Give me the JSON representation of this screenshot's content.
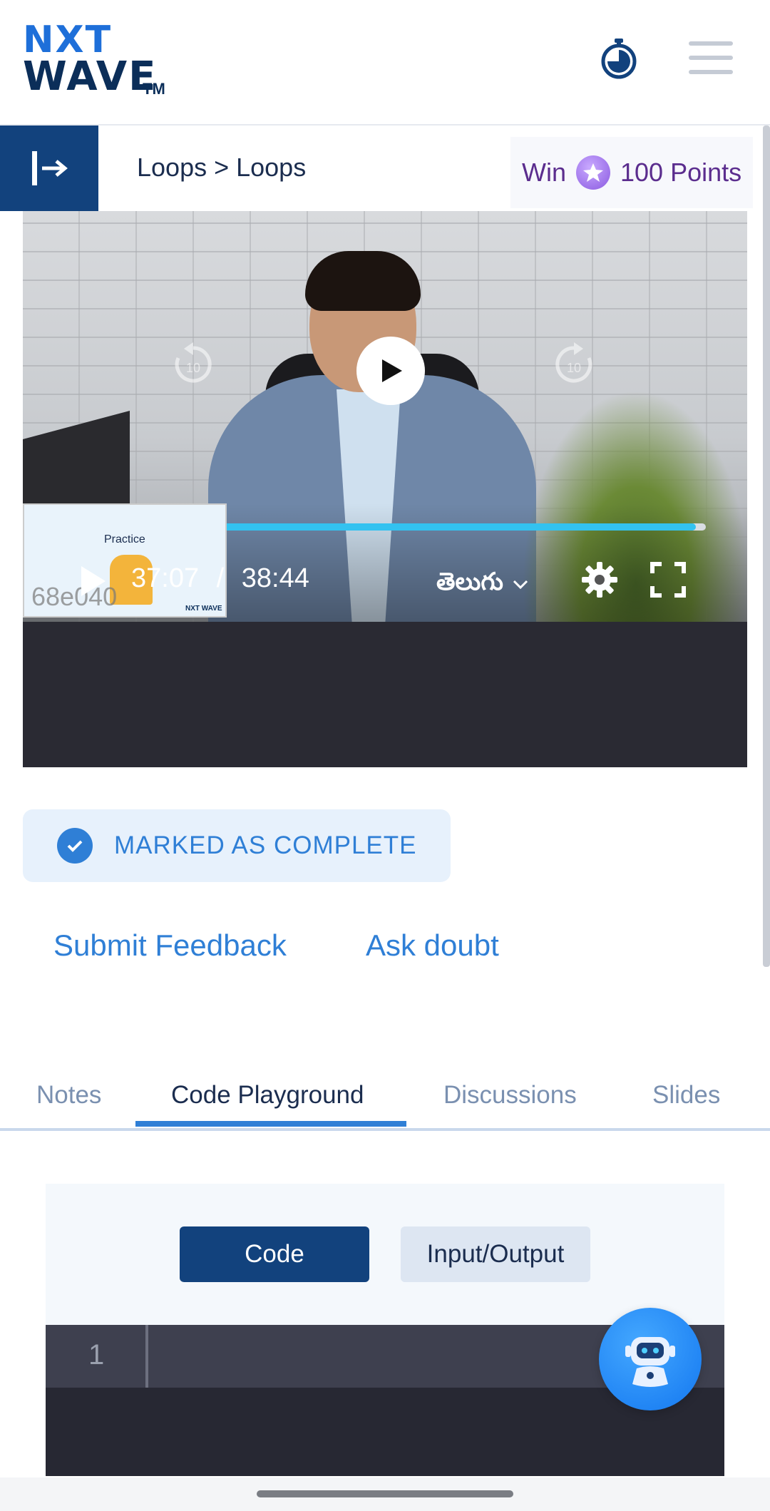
{
  "brand": {
    "logo_top": "NXT",
    "logo_bottom": "WAVE",
    "logo_tm": "TM",
    "accent": "#2f7fd6",
    "navy": "#12427d"
  },
  "header": {
    "timer_icon": "stopwatch-icon",
    "menu_icon": "hamburger-menu-icon"
  },
  "breadcrumb": {
    "text": "Loops > Loops"
  },
  "reward": {
    "win_label": "Win",
    "points_label": "100 Points",
    "coin_icon": "star-coin-icon"
  },
  "video": {
    "current_time": "37:07",
    "separator": "/",
    "duration": "38:44",
    "progress_fraction": 0.985,
    "language": "తెలుగు",
    "watermark": "68e040",
    "thumbnail_caption": "Practice",
    "thumbnail_logo": "NXT WAVE",
    "skip_back": "10",
    "skip_forward": "10"
  },
  "completion": {
    "label": "MARKED AS COMPLETE"
  },
  "actions": {
    "feedback": "Submit Feedback",
    "doubt": "Ask doubt"
  },
  "tabs": [
    {
      "label": "Notes",
      "active": false
    },
    {
      "label": "Code Playground",
      "active": true
    },
    {
      "label": "Discussions",
      "active": false
    },
    {
      "label": "Slides",
      "active": false
    }
  ],
  "playground": {
    "code_tab": "Code",
    "io_tab": "Input/Output",
    "line_number": "1"
  }
}
